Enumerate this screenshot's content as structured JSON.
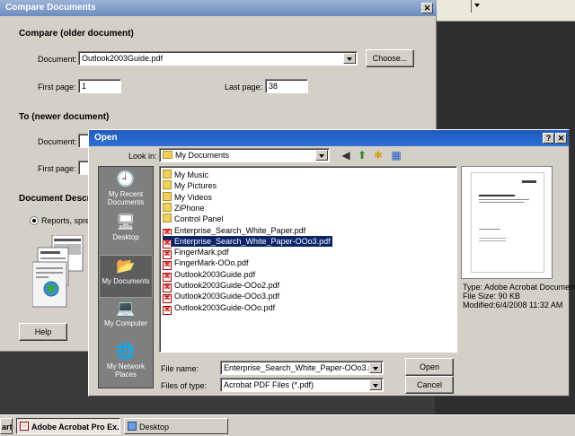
{
  "compare_dialog": {
    "title": "Compare Documents",
    "close_glyph": "✕",
    "older_heading": "Compare (older document)",
    "document_label": "Document:",
    "older_document_value": "Outlook2003Guide.pdf",
    "choose_button": "Choose...",
    "first_page_label": "First page:",
    "first_page_value": "1",
    "last_page_label": "Last page:",
    "last_page_value": "38",
    "newer_heading": "To (newer document)",
    "newer_document_label": "Document:",
    "newer_first_page_label": "First page:",
    "description_heading": "Document Descrip",
    "radio_label": "Reports, spread",
    "help_button": "Help"
  },
  "open_dialog": {
    "title": "Open",
    "help_glyph": "?",
    "close_glyph": "✕",
    "look_in_label": "Look in:",
    "look_in_value": "My Documents",
    "places": [
      {
        "label": "My Recent Documents",
        "icon": "recent-documents-icon",
        "glyph": "🕘"
      },
      {
        "label": "Desktop",
        "icon": "desktop-icon",
        "glyph": "🖥"
      },
      {
        "label": "My Documents",
        "icon": "my-documents-icon",
        "glyph": "📂"
      },
      {
        "label": "My Computer",
        "icon": "my-computer-icon",
        "glyph": "💻"
      },
      {
        "label": "My Network Places",
        "icon": "network-places-icon",
        "glyph": "🌐"
      }
    ],
    "files": [
      {
        "name": "My Music",
        "kind": "folder"
      },
      {
        "name": "My Pictures",
        "kind": "folder"
      },
      {
        "name": "My Videos",
        "kind": "folder"
      },
      {
        "name": "ZiPhone",
        "kind": "folder"
      },
      {
        "name": "Control Panel",
        "kind": "folder"
      },
      {
        "name": "Enterprise_Search_White_Paper.pdf",
        "kind": "pdf"
      },
      {
        "name": "Enterprise_Search_White_Paper-OOo3.pdf",
        "kind": "pdf",
        "selected": true
      },
      {
        "name": "FingerMark.pdf",
        "kind": "pdf"
      },
      {
        "name": "FingerMark-OOo.pdf",
        "kind": "pdf"
      },
      {
        "name": "Outlook2003Guide.pdf",
        "kind": "pdf"
      },
      {
        "name": "Outlook2003Guide-OOo2.pdf",
        "kind": "pdf"
      },
      {
        "name": "Outlook2003Guide-OOo3.pdf",
        "kind": "pdf"
      },
      {
        "name": "Outlook2003Guide-OOo.pdf",
        "kind": "pdf"
      }
    ],
    "preview_type": "Type: Adobe Acrobat Document",
    "preview_size": "File Size: 90 KB",
    "preview_modified": "Modified:6/4/2008 11:32 AM",
    "file_name_label": "File name:",
    "file_name_value": "Enterprise_Search_White_Paper-OOo3.pdf",
    "files_of_type_label": "Files of type:",
    "files_of_type_value": "Acrobat PDF Files (*.pdf)",
    "open_button": "Open",
    "cancel_button": "Cancel"
  },
  "taskbar": {
    "start_label": "art",
    "tasks": [
      {
        "label": "Adobe Acrobat Pro Ex...",
        "active": true
      },
      {
        "label": "Desktop",
        "active": false
      }
    ]
  },
  "colors": {
    "selection": "#0a246a",
    "titlebar_active": "#1f5bbd",
    "titlebar_inactive": "#9db3d6",
    "dialog_face": "#d4d0c8"
  }
}
